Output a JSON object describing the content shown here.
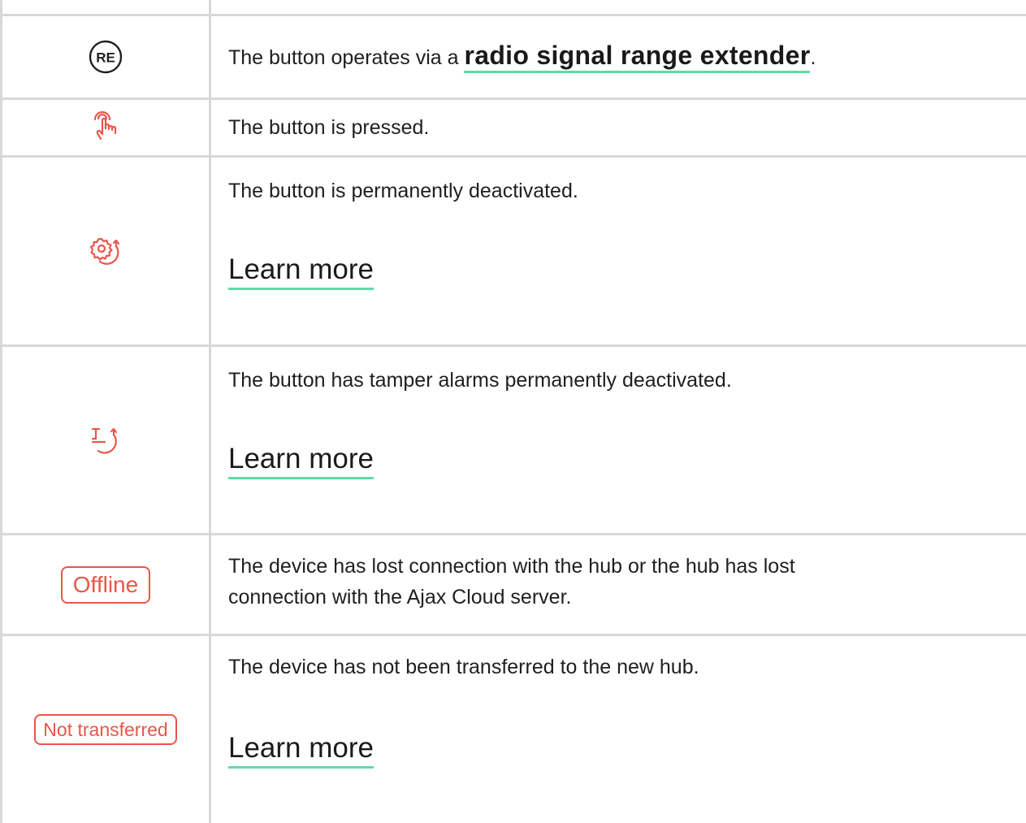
{
  "rows": [
    {
      "icon": "range-extender-icon",
      "icon_text": "RE",
      "text_before": "The button operates via a ",
      "link": "radio signal range extender",
      "text_after": "."
    },
    {
      "icon": "finger-press-icon",
      "text": "The button is pressed."
    },
    {
      "icon": "gear-deactivated-icon",
      "text": "The button is permanently deactivated.",
      "link": "Learn more"
    },
    {
      "icon": "tamper-deactivated-icon",
      "text": "The button has tamper alarms permanently deactivated.",
      "link": "Learn more"
    },
    {
      "icon": "offline-badge",
      "badge": "Offline",
      "text_line1": "The device has lost connection with the hub or the hub has lost",
      "text_line2": "connection with the Ajax Cloud server."
    },
    {
      "icon": "not-transferred-badge",
      "badge": "Not transferred",
      "text": "The device has not been transferred to the new hub.",
      "link": "Learn more"
    }
  ],
  "colors": {
    "accent_red": "#e8574a",
    "link_underline": "#5ddca5",
    "border": "#d8d8d8",
    "text": "#1f1f1f"
  }
}
